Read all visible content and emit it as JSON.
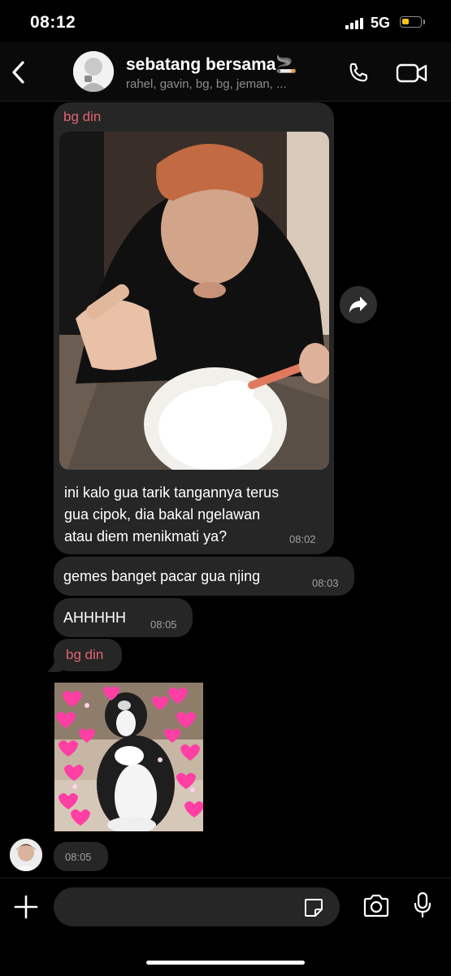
{
  "status_bar": {
    "time": "08:12",
    "network": "5G",
    "battery_level": 0.4,
    "battery_color": "#f5c518"
  },
  "header": {
    "group_name": "sebatang bersama🚬",
    "members": "rahel, gavin, bg, bg, jeman, ...",
    "back_icon": "chevron-left-icon",
    "call_icon": "phone-icon",
    "video_icon": "video-camera-icon"
  },
  "messages": {
    "msg1": {
      "sender": "bg din",
      "text_lines": [
        "ini kalo gua tarik tangannya terus",
        "gua cipok, dia bakal ngelawan",
        "atau diem menikmati ya?"
      ],
      "time": "08:02"
    },
    "msg2": {
      "text": "gemes banget pacar gua njing",
      "time": "08:03"
    },
    "msg3": {
      "text": "AHHHHH",
      "time": "08:05"
    },
    "msg4": {
      "sender": "bg din"
    },
    "msg5": {
      "time": "08:05"
    }
  },
  "forward_icon": "share-arrow-icon",
  "composer": {
    "placeholder": "",
    "add_icon": "plus-icon",
    "sticker_icon": "sticker-icon",
    "camera_icon": "camera-icon",
    "mic_icon": "microphone-icon"
  },
  "colors": {
    "background": "#000000",
    "bubble": "#262626",
    "sender_name": "#e0636e",
    "timestamp": "#a0a0a0"
  }
}
